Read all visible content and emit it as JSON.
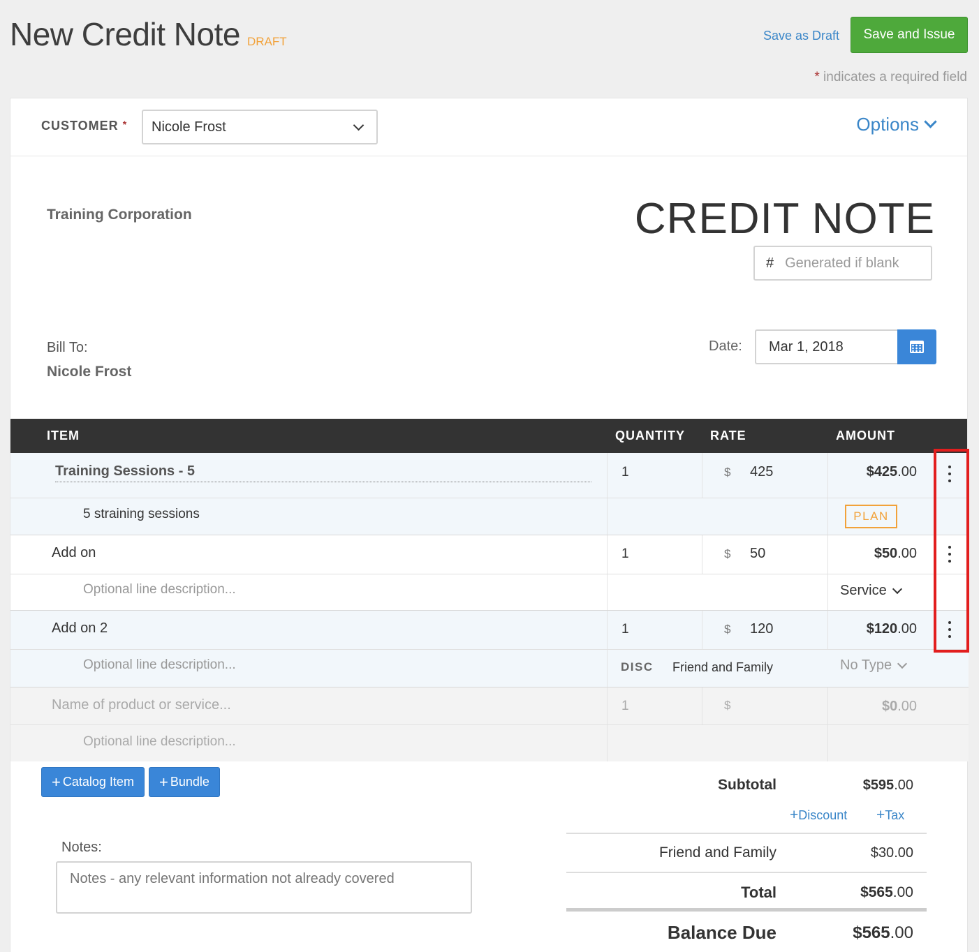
{
  "header": {
    "title": "New Credit Note",
    "status": "DRAFT",
    "save_draft_label": "Save as Draft",
    "save_issue_label": "Save and Issue",
    "required_note": "indicates a required field",
    "required_star": "*"
  },
  "customer": {
    "label": "CUSTOMER",
    "required_star": "*",
    "selected": "Nicole Frost",
    "options_label": "Options"
  },
  "document": {
    "company": "Training Corporation",
    "title": "CREDIT NOTE",
    "number_prefix": "#",
    "number_placeholder": "Generated if blank",
    "bill_to_label": "Bill To:",
    "bill_to_name": "Nicole Frost",
    "date_label": "Date:",
    "date_value": "Mar 1, 2018"
  },
  "table": {
    "headers": [
      "ITEM",
      "QUANTITY",
      "RATE",
      "AMOUNT"
    ],
    "currency_symbol": "$",
    "lines": [
      {
        "name": "Training Sessions - 5",
        "description": "5 straining sessions",
        "quantity": "1",
        "rate": "425",
        "amount_whole": "425",
        "amount_cents": ".00",
        "badge": "PLAN"
      },
      {
        "name": "Add on",
        "description_placeholder": "Optional line description...",
        "quantity": "1",
        "rate": "50",
        "amount_whole": "50",
        "amount_cents": ".00",
        "type": "Service"
      },
      {
        "name": "Add on 2",
        "description_placeholder": "Optional line description...",
        "quantity": "1",
        "rate": "120",
        "amount_whole": "120",
        "amount_cents": ".00",
        "discount_label": "DISC",
        "discount_name": "Friend and Family",
        "type": "No Type"
      }
    ],
    "new_line": {
      "name_placeholder": "Name of product or service...",
      "description_placeholder": "Optional line description...",
      "quantity": "1",
      "amount_whole": "0",
      "amount_cents": ".00"
    }
  },
  "actions": {
    "catalog_item_label": "Catalog Item",
    "bundle_label": "Bundle"
  },
  "notes": {
    "label": "Notes:",
    "placeholder": "Notes - any relevant information not already covered"
  },
  "totals": {
    "subtotal_label": "Subtotal",
    "subtotal_whole": "595",
    "subtotal_cents": ".00",
    "add_discount_label": "Discount",
    "add_tax_label": "Tax",
    "discount_name": "Friend and Family",
    "discount_whole": "30",
    "discount_cents": ".00",
    "total_label": "Total",
    "total_whole": "565",
    "total_cents": ".00",
    "balance_label": "Balance Due",
    "balance_whole": "565",
    "balance_cents": ".00"
  },
  "colors": {
    "save_issue_button": "#4ea93b",
    "link": "#3a86c8",
    "draft": "#f2a23a",
    "highlight_box": "#e21e1e",
    "table_header": "#333333"
  }
}
